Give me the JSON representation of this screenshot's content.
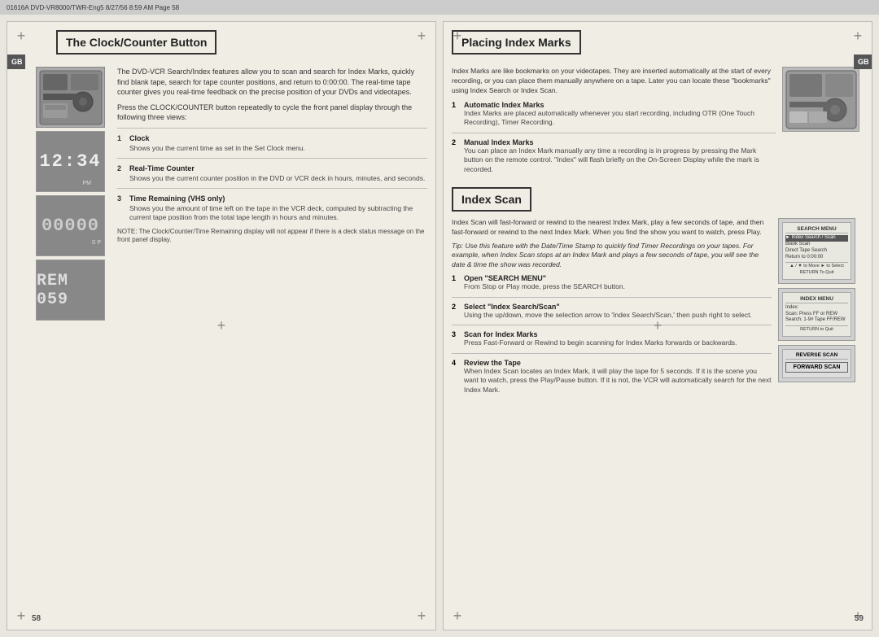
{
  "meta": {
    "top_bar_text": "01616A DVD-VR8000/TWR-Eng5  8/27/56  8:59 AM  Page 58"
  },
  "left_page": {
    "gb_badge": "GB",
    "section_title": "The Clock/Counter Button",
    "intro_text_1": "The DVD-VCR Search/Index features allow you to scan and search for Index Marks, quickly find blank tape, search for tape counter positions, and return to 0:00:00. The real-time tape counter gives you real-time feedback on the precise position of your DVDs and videotapes.",
    "intro_text_2": "Press the CLOCK/COUNTER button repeatedly to cycle the front panel display through the following three views:",
    "items": [
      {
        "number": "1",
        "title": "Clock",
        "description": "Shows you the current time as set in the Set Clock menu."
      },
      {
        "number": "2",
        "title": "Real-Time Counter",
        "description": "Shows you the current counter position in the DVD or VCR deck in hours, minutes, and seconds."
      },
      {
        "number": "3",
        "title": "Time Remaining (VHS only)",
        "description": "Shows you the amount of time left on the tape in the VCR deck, computed by subtracting the current tape position from the total tape length in hours and minutes."
      }
    ],
    "note_text": "NOTE: The Clock/Counter/Time Remaining display will not appear if there is a deck status message on the front panel display.",
    "display_1": "12:34",
    "display_2": "00000",
    "display_3": "REM 059",
    "sp_label": "S P",
    "pm_label": "PM",
    "page_number": "58"
  },
  "right_page": {
    "gb_badge": "GB",
    "section_title_placing": "Placing Index Marks",
    "placing_intro": "Index Marks are like bookmarks on your videotapes. They are inserted automatically at the start of every recording, or you can place them manually anywhere on a tape. Later you can locate these \"bookmarks\" using Index Search or Index Scan.",
    "placing_items": [
      {
        "number": "1",
        "title": "Automatic Index Marks",
        "description": "Index Marks are placed automatically whenever you start recording, including OTR (One Touch Recording), Timer Recording."
      },
      {
        "number": "2",
        "title": "Manual Index Marks",
        "description": "You can place an Index Mark manually any time a recording is in progress by pressing the Mark button on the remote control. \"Index\" will flash briefly on the On-Screen Display while the mark is recorded."
      }
    ],
    "section_title_scan": "Index Scan",
    "scan_intro": "Index Scan will fast-forward or rewind to the nearest Index Mark, play a few seconds of tape, and then fast-forward or rewind to the next Index Mark. When you find the show you want to watch, press Play.",
    "tip_text": "Tip: Use this feature with the Date/Time Stamp to quickly find Timer Recordings on your tapes. For example, when Index Scan stops at an Index Mark and plays a few seconds of tape, you will see the date & time the show was recorded.",
    "scan_items": [
      {
        "number": "1",
        "title": "Open \"SEARCH MENU\"",
        "description": "From Stop or Play mode, press the SEARCH button."
      },
      {
        "number": "2",
        "title": "Select \"Index Search/Scan\"",
        "description": "Using the up/down, move the selection arrow to 'Index Search/Scan,' then push right to select."
      },
      {
        "number": "3",
        "title": "Scan for Index Marks",
        "description": "Press Fast-Forward or Rewind to begin scanning for Index Marks forwards or backwards."
      },
      {
        "number": "4",
        "title": "Review the Tape",
        "description": "When Index Scan locates an Index Mark, it will play the tape for 5 seconds. If it is the scene you want to watch, press the Play/Pause button. If it is not, the VCR will automatically search for the next Index Mark."
      }
    ],
    "search_menu": {
      "title": "SEARCH MENU",
      "items": [
        "Index Search / Scan",
        "Blank Scan",
        "Direct Tape Search",
        "Return to 0:00:00"
      ],
      "selected": "Index Search / Scan",
      "nav_hint": "▲ / ▼ to Move     ► to Select\nRETURN To Quit"
    },
    "index_menu": {
      "title": "INDEX MENU",
      "items": [
        "Index:"
      ],
      "scan_line": "Scan:  Press FF or REW",
      "search_line": "Search: 1-9# Tape FF/REW",
      "return_line": "RETURN to Quit"
    },
    "reverse_scan_label": "REVERSE SCAN",
    "forward_scan_label": "FORWARD SCAN",
    "page_number": "59"
  }
}
